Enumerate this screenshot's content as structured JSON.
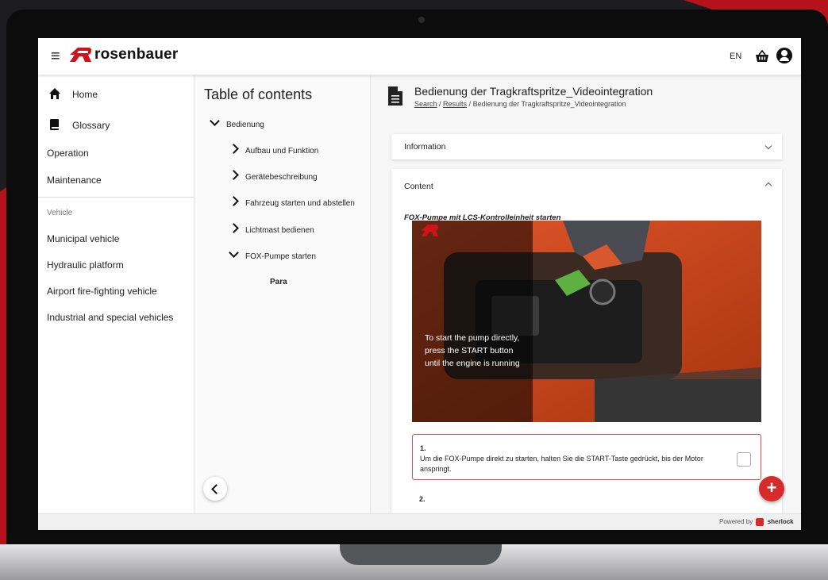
{
  "header": {
    "brand": "rosenbauer",
    "language": "EN",
    "menu_icon": "hamburger-icon",
    "basket_icon": "basket-icon",
    "user_icon": "user-circle-icon"
  },
  "sidebar": {
    "home": "Home",
    "glossary": "Glossary",
    "operation": "Operation",
    "maintenance": "Maintenance",
    "vehicle_heading": "Vehicle",
    "vehicles": [
      "Municipal vehicle",
      "Hydraulic platform",
      "Airport fire-fighting vehicle",
      "Industrial and special vehicles"
    ]
  },
  "toc": {
    "title": "Table of contents",
    "root": "Bedienung",
    "items": [
      "Aufbau und Funktion",
      "Gerätebeschreibung",
      "Fahrzeug starten und abstellen",
      "Lichtmast bedienen",
      "FOX-Pumpe starten"
    ],
    "sub": "Para"
  },
  "main": {
    "title": "Bedienung der Tragkraftspritze_Videointegration",
    "breadcrumb": {
      "search": "Search",
      "results": "Results",
      "current": "Bedienung der Tragkraftspritze_Videointegration",
      "sep": " / "
    },
    "information": "Information",
    "content": "Content",
    "section_title": "FOX-Pumpe mit LCS-Kontrolleinheit starten",
    "video_caption": [
      "To start the pump directly,",
      "press the START button",
      "until the engine is running"
    ],
    "step1_num": "1.",
    "step1_text": "Um die FOX-Pumpe direkt zu starten, halten Sie die START-Taste gedrückt, bis der Motor anspringt.",
    "step2_num": "2."
  },
  "footer": {
    "powered_by": "Powered by",
    "brand": "sherlock"
  },
  "colors": {
    "accent": "#d62b2b",
    "brand_red": "#b5121b"
  }
}
